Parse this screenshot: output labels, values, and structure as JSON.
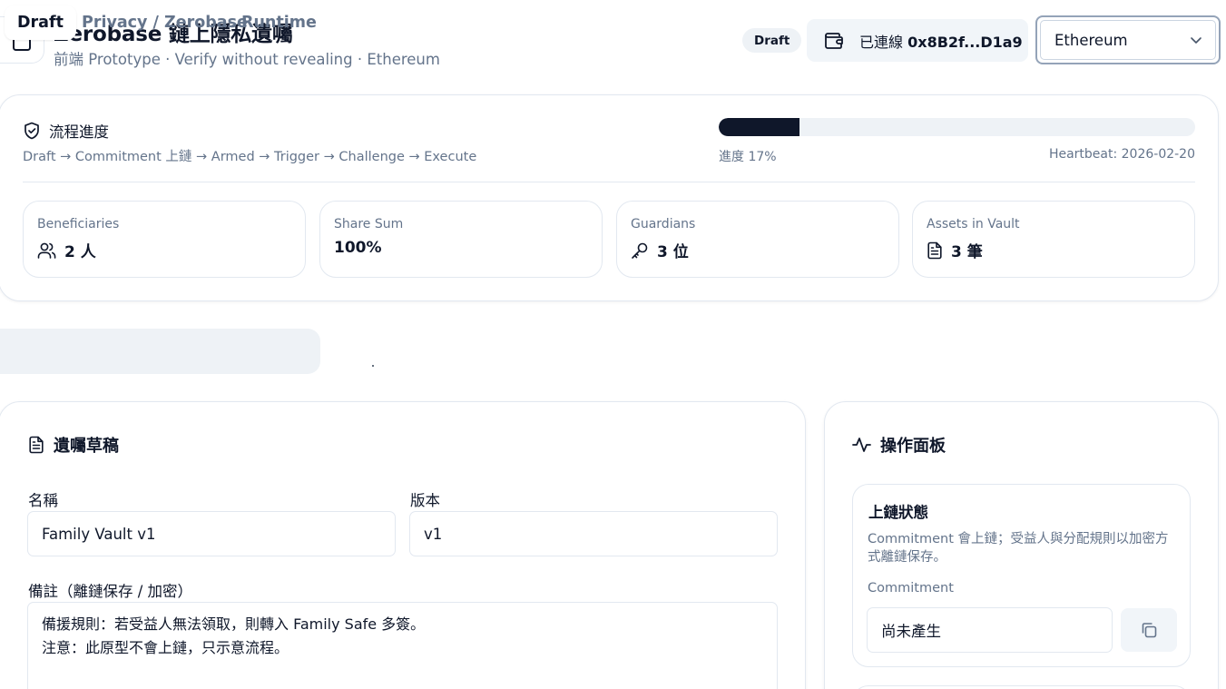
{
  "header": {
    "title": "Zerobase 鏈上隱私遺囑",
    "subtitle": "前端 Prototype · Verify without revealing · Ethereum",
    "status_badge": "Draft",
    "wallet": {
      "prefix": "已連線",
      "address": "0x8B2f...D1a9"
    },
    "network": {
      "selected": "Ethereum"
    }
  },
  "progress": {
    "title": "流程進度",
    "steps": "Draft → Commitment 上鏈 → Armed → Trigger → Challenge → Execute",
    "percent": 17,
    "percent_label": "進度 17%",
    "heartbeat": "Heartbeat: 2026-02-20"
  },
  "stats": [
    {
      "label": "Beneficiaries",
      "value": "2 人",
      "icon": "users-icon"
    },
    {
      "label": "Share Sum",
      "value": "100%",
      "icon": ""
    },
    {
      "label": "Guardians",
      "value": "3 位",
      "icon": "key-icon"
    },
    {
      "label": "Assets in Vault",
      "value": "3 筆",
      "icon": "document-icon"
    }
  ],
  "tabs": [
    {
      "label": "Draft",
      "active": true
    },
    {
      "label": "Privacy / Zerobase",
      "active": false
    },
    {
      "label": "Runtime",
      "active": false
    }
  ],
  "draft": {
    "title": "遺囑草稿",
    "name_label": "名稱",
    "name_value": "Family Vault v1",
    "version_label": "版本",
    "version_value": "v1",
    "notes_label": "備註（離鏈保存 / 加密）",
    "notes_line1": "備援規則：若受益人無法領取，則轉入 Family Safe 多簽。",
    "notes_line2": "注意：此原型不會上鏈，只示意流程。"
  },
  "ops": {
    "title": "操作面板",
    "chain_status": {
      "title": "上鏈狀態",
      "description": "Commitment 會上鏈；受益人與分配規則以加密方式離鏈保存。",
      "commitment_label": "Commitment",
      "commitment_value": "尚未產生"
    }
  },
  "colors": {
    "accent": "#0f172a",
    "muted_text": "#64748b",
    "border": "#e2e8f0",
    "surface": "#f1f5f9"
  }
}
